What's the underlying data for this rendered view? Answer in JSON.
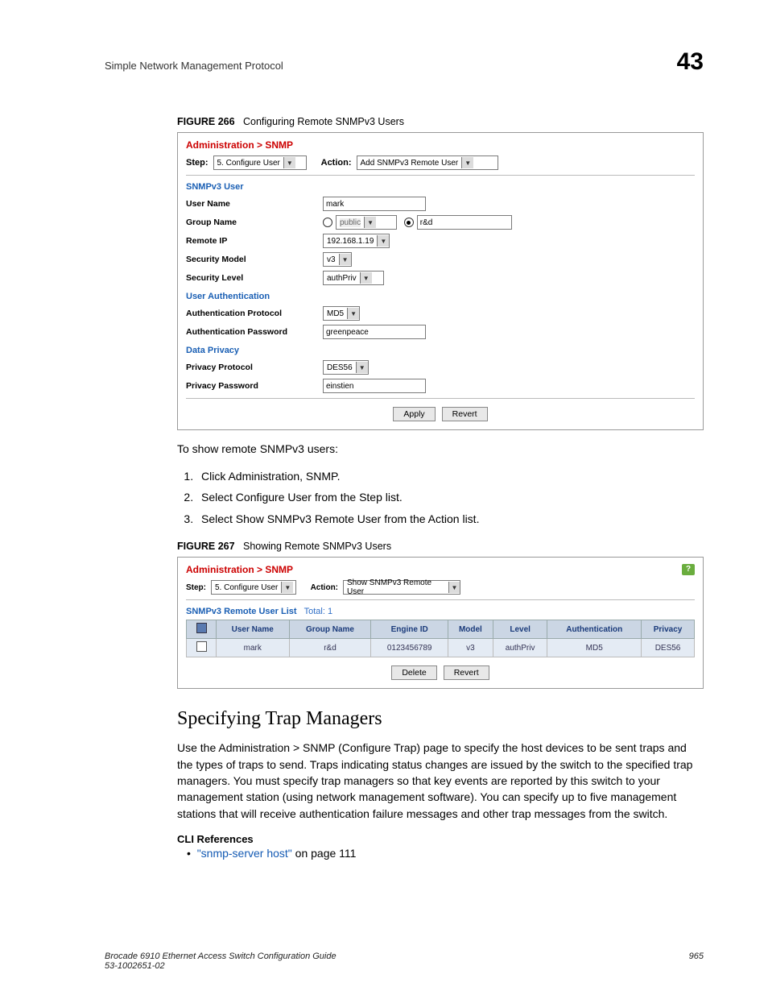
{
  "header": {
    "left": "Simple Network Management Protocol",
    "right": "43"
  },
  "figure266": {
    "label": "FIGURE 266",
    "title": "Configuring Remote SNMPv3 Users"
  },
  "panel1": {
    "breadcrumb": "Administration > SNMP",
    "step_label": "Step:",
    "step_value": "5. Configure User",
    "action_label": "Action:",
    "action_value": "Add SNMPv3 Remote User",
    "section_user": "SNMPv3 User",
    "rows": {
      "user_name_label": "User Name",
      "user_name_value": "mark",
      "group_name_label": "Group Name",
      "group_public": "public",
      "group_rd": "r&d",
      "remote_ip_label": "Remote IP",
      "remote_ip_value": "192.168.1.19",
      "sec_model_label": "Security Model",
      "sec_model_value": "v3",
      "sec_level_label": "Security Level",
      "sec_level_value": "authPriv"
    },
    "section_auth": "User Authentication",
    "auth": {
      "proto_label": "Authentication Protocol",
      "proto_value": "MD5",
      "pass_label": "Authentication Password",
      "pass_value": "greenpeace"
    },
    "section_priv": "Data Privacy",
    "priv": {
      "proto_label": "Privacy Protocol",
      "proto_value": "DES56",
      "pass_label": "Privacy Password",
      "pass_value": "einstien"
    },
    "apply": "Apply",
    "revert": "Revert"
  },
  "body1": "To show remote SNMPv3 users:",
  "steps": [
    "Click Administration, SNMP.",
    "Select Configure User from the Step list.",
    "Select Show SNMPv3 Remote User from the Action list."
  ],
  "figure267": {
    "label": "FIGURE 267",
    "title": "Showing Remote SNMPv3 Users"
  },
  "panel2": {
    "breadcrumb": "Administration > SNMP",
    "step_label": "Step:",
    "step_value": "5. Configure User",
    "action_label": "Action:",
    "action_value": "Show SNMPv3 Remote User",
    "list_title": "SNMPv3 Remote User List",
    "total_label": "Total: 1",
    "headers": [
      "",
      "User Name",
      "Group Name",
      "Engine ID",
      "Model",
      "Level",
      "Authentication",
      "Privacy"
    ],
    "row": [
      "",
      "mark",
      "r&d",
      "0123456789",
      "v3",
      "authPriv",
      "MD5",
      "DES56"
    ],
    "delete": "Delete",
    "revert": "Revert"
  },
  "section_heading": "Specifying Trap Managers",
  "para": "Use the Administration > SNMP (Configure Trap) page to specify the host devices to be sent traps and the types of traps to send. Traps indicating status changes are issued by the switch to the specified trap managers. You must specify trap managers so that key events are reported by this switch to your management station (using network management software). You can specify up to five management stations that will receive authentication failure messages and other trap messages from the switch.",
  "cli_head": "CLI References",
  "cli_link_text": "\"snmp-server host\"",
  "cli_link_suffix": " on page 111",
  "footer": {
    "left1": "Brocade 6910 Ethernet Access Switch Configuration Guide",
    "left2": "53-1002651-02",
    "right": "965"
  }
}
